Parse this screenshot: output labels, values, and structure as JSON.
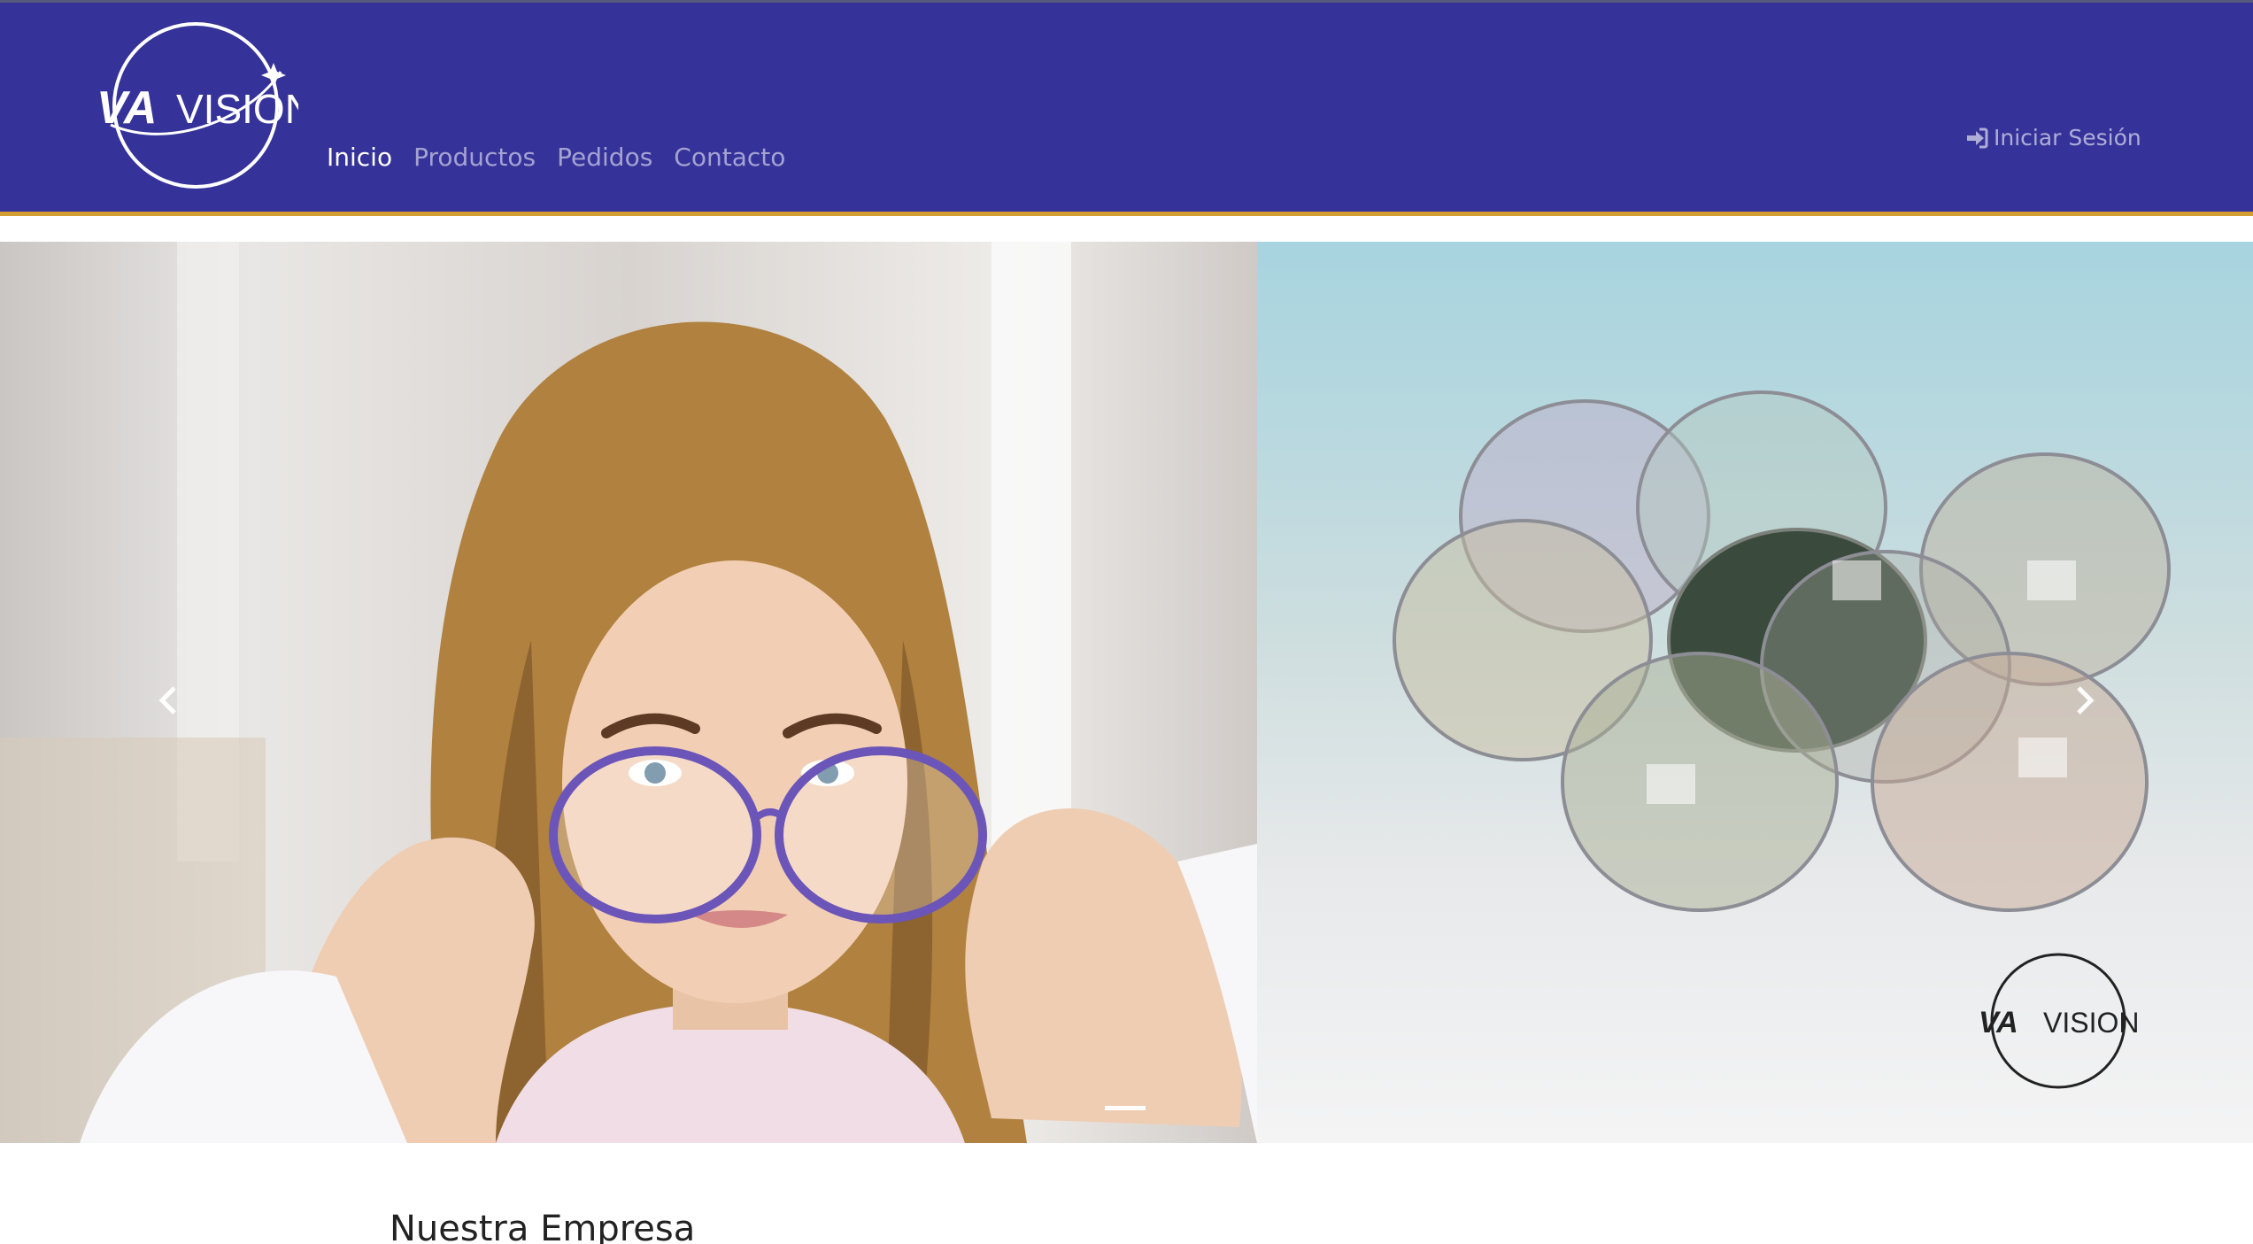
{
  "brand": {
    "logo_text_left": "VA",
    "logo_text_right": "VISION"
  },
  "nav": {
    "items": [
      {
        "label": "Inicio",
        "active": true
      },
      {
        "label": "Productos",
        "active": false
      },
      {
        "label": "Pedidos",
        "active": false
      },
      {
        "label": "Contacto",
        "active": false
      }
    ],
    "login_label": "Iniciar Sesión",
    "login_icon": "sign-in-icon"
  },
  "colors": {
    "navbar_bg": "#35329a",
    "navbar_accent_border": "#d39e32"
  },
  "carousel": {
    "prev_icon": "chevron-left-icon",
    "next_icon": "chevron-right-icon",
    "indicators": [
      {
        "active": true
      }
    ],
    "slide_logo_left": "VA",
    "slide_logo_right": "VISION"
  },
  "content": {
    "section_title": "Nuestra Empresa"
  }
}
